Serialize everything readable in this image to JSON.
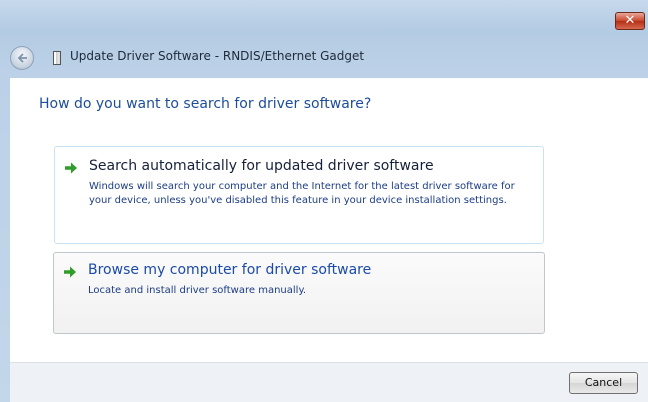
{
  "window": {
    "close_glyph": "✕",
    "title": "Update Driver Software - RNDIS/Ethernet Gadget"
  },
  "main": {
    "heading": "How do you want to search for driver software?",
    "options": [
      {
        "title": "Search automatically for updated driver software",
        "description": "Windows will search your computer and the Internet for the latest driver software for your device, unless you've disabled this feature in your device installation settings."
      },
      {
        "title": "Browse my computer for driver software",
        "description": "Locate and install driver software manually."
      }
    ]
  },
  "footer": {
    "cancel_label": "Cancel"
  },
  "icons": {
    "back": "back-arrow-icon",
    "device": "device-icon",
    "option_arrow": "green-arrow-icon"
  },
  "colors": {
    "heading": "#1d4e9a",
    "link": "#1b4aa8",
    "arrow": "#2f9d28",
    "close": "#c9452b"
  }
}
